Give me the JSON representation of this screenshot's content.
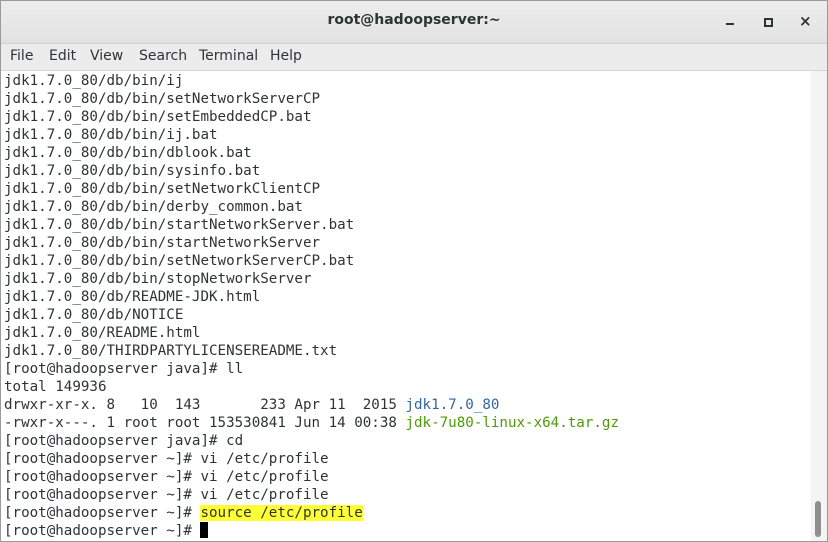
{
  "window": {
    "title": "root@hadoopserver:~",
    "minimize_icon": "minimize-icon",
    "maximize_icon": "maximize-icon",
    "close_icon": "close-icon",
    "close_glyph": "×"
  },
  "menu": {
    "file": "File",
    "edit": "Edit",
    "view": "View",
    "search": "Search",
    "terminal": "Terminal",
    "help": "Help"
  },
  "colors": {
    "highlight": "#ffff33",
    "directory": "#3465a4",
    "archive": "#4e9a06"
  },
  "terminal": {
    "lines": [
      "jdk1.7.0_80/db/bin/ij",
      "jdk1.7.0_80/db/bin/setNetworkServerCP",
      "jdk1.7.0_80/db/bin/setEmbeddedCP.bat",
      "jdk1.7.0_80/db/bin/ij.bat",
      "jdk1.7.0_80/db/bin/dblook.bat",
      "jdk1.7.0_80/db/bin/sysinfo.bat",
      "jdk1.7.0_80/db/bin/setNetworkClientCP",
      "jdk1.7.0_80/db/bin/derby_common.bat",
      "jdk1.7.0_80/db/bin/startNetworkServer.bat",
      "jdk1.7.0_80/db/bin/startNetworkServer",
      "jdk1.7.0_80/db/bin/setNetworkServerCP.bat",
      "jdk1.7.0_80/db/bin/stopNetworkServer",
      "jdk1.7.0_80/db/README-JDK.html",
      "jdk1.7.0_80/db/NOTICE",
      "jdk1.7.0_80/README.html",
      "jdk1.7.0_80/THIRDPARTYLICENSEREADME.txt",
      "[root@hadoopserver java]# ll",
      "total 149936"
    ],
    "ls_rows": [
      {
        "perms": "drwxr-xr-x. 8   10  143       233 Apr 11  2015 ",
        "name": "jdk1.7.0_80"
      },
      {
        "perms": "-rwxr-x---. 1 root root 153530841 Jun 14 00:38 ",
        "name": "jdk-7u80-linux-x64.tar.gz"
      }
    ],
    "cmds": [
      "[root@hadoopserver java]# cd",
      "[root@hadoopserver ~]# vi /etc/profile",
      "[root@hadoopserver ~]# vi /etc/profile",
      "[root@hadoopserver ~]# vi /etc/profile"
    ],
    "highlight_prompt": "[root@hadoopserver ~]# ",
    "highlight_cmd": "source /etc/profile",
    "final_prompt": "[root@hadoopserver ~]# "
  }
}
